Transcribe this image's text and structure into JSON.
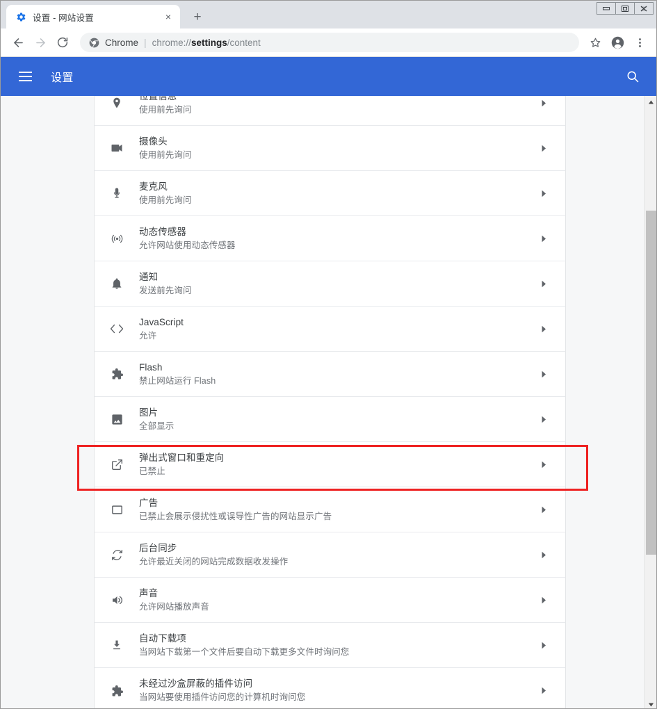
{
  "window": {
    "minimize_label": "最小化",
    "maximize_label": "还原",
    "close_label": "关闭"
  },
  "tab": {
    "title": "设置 - 网站设置",
    "favicon": "gear-icon",
    "close_label": "×",
    "newtab_label": "+"
  },
  "toolbar": {
    "back_label": "←",
    "forward_label": "→",
    "reload_label": "⟳",
    "omnibox": {
      "chrome_icon": "chrome-icon",
      "scheme_label": "Chrome",
      "separator": "|",
      "url_prefix": "chrome://",
      "url_bold": "settings",
      "url_suffix": "/content",
      "url_full": "chrome://settings/content"
    },
    "bookmark_label": "☆",
    "profile_label": "个人资料",
    "menu_label": "⋮"
  },
  "settings_header": {
    "menu_label": "主菜单",
    "title": "设置",
    "search_label": "搜索设置"
  },
  "content_settings": {
    "arrow_glyph": "▶",
    "rows": [
      {
        "icon": "location-icon",
        "title": "位置信息",
        "subtitle": "使用前先询问",
        "highlighted": false
      },
      {
        "icon": "camera-icon",
        "title": "摄像头",
        "subtitle": "使用前先询问",
        "highlighted": false
      },
      {
        "icon": "microphone-icon",
        "title": "麦克风",
        "subtitle": "使用前先询问",
        "highlighted": false
      },
      {
        "icon": "motion-sensor-icon",
        "title": "动态传感器",
        "subtitle": "允许网站使用动态传感器",
        "highlighted": false
      },
      {
        "icon": "notification-bell-icon",
        "title": "通知",
        "subtitle": "发送前先询问",
        "highlighted": false
      },
      {
        "icon": "code-brackets-icon",
        "title": "JavaScript",
        "subtitle": "允许",
        "highlighted": false
      },
      {
        "icon": "flash-puzzle-icon",
        "title": "Flash",
        "subtitle": "禁止网站运行 Flash",
        "highlighted": true
      },
      {
        "icon": "image-icon",
        "title": "图片",
        "subtitle": "全部显示",
        "highlighted": false
      },
      {
        "icon": "popup-window-icon",
        "title": "弹出式窗口和重定向",
        "subtitle": "已禁止",
        "highlighted": false
      },
      {
        "icon": "ads-icon",
        "title": "广告",
        "subtitle": "已禁止会展示侵扰性或误导性广告的网站显示广告",
        "highlighted": false
      },
      {
        "icon": "background-sync-icon",
        "title": "后台同步",
        "subtitle": "允许最近关闭的网站完成数据收发操作",
        "highlighted": false
      },
      {
        "icon": "sound-icon",
        "title": "声音",
        "subtitle": "允许网站播放声音",
        "highlighted": false
      },
      {
        "icon": "download-icon",
        "title": "自动下载项",
        "subtitle": "当网站下载第一个文件后要自动下载更多文件时询问您",
        "highlighted": false
      },
      {
        "icon": "unsandboxed-plugin-icon",
        "title": "未经过沙盒屏蔽的插件访问",
        "subtitle": "当网站要使用插件访问您的计算机时询问您",
        "highlighted": false
      }
    ]
  },
  "scrollbar": {
    "up_label": "▲",
    "down_label": "▼"
  },
  "colors": {
    "header_blue": "#3367d6",
    "annotation_red": "#ee2222",
    "card_white": "#ffffff",
    "page_gray": "#f6f7f8"
  }
}
